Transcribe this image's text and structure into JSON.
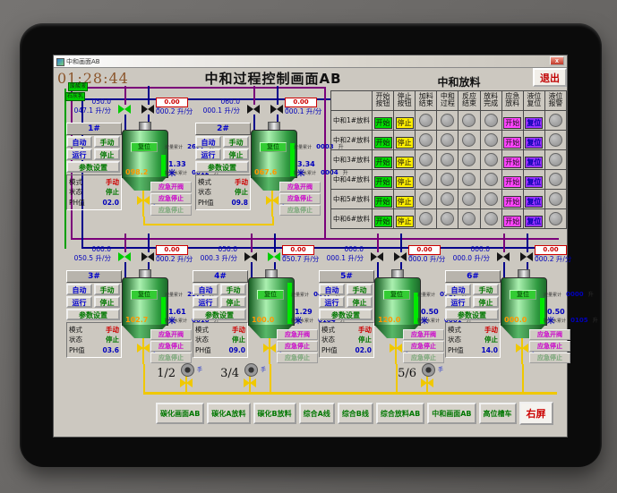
{
  "window": {
    "titlebar": {
      "title": "中和画面AB",
      "close": "x"
    },
    "header": {
      "time": "01:28:44",
      "title": "中和过程控制画面AB",
      "section": "中和放料",
      "exit": "退出"
    }
  },
  "labels": {
    "auto": "自动",
    "manual": "手动",
    "run": "运行",
    "stop": "停止",
    "params": "参数设置",
    "mode": "模式",
    "state": "状态",
    "ph": "PH值",
    "emg_open": "应急开阀",
    "emg_stop": "应急停止",
    "emg_stop2": "应急停止",
    "tank_btn": "复位",
    "flow_unit": "升/分",
    "total_unit": "升",
    "total1": "液量累计",
    "total2": "掺加水累计",
    "hand": "手"
  },
  "sources": [
    "废酸液",
    "石灰乳"
  ],
  "units_top": [
    {
      "id": "1#",
      "fl_sp": "050.0",
      "fl_pv": "047.1",
      "fr_sp": "0.00",
      "fr_pv": "000.2",
      "t1": "2677",
      "t2": "0012",
      "tank": "098.2",
      "level": "1.33 米",
      "mode": "手动",
      "state": "停止",
      "ph": "02.0",
      "lvl": "46%",
      "v1": "#00cc00",
      "v2": "#151515"
    },
    {
      "id": "2#",
      "fl_sp": "060.0",
      "fl_pv": "000.1",
      "fr_sp": "0.00",
      "fr_pv": "000.1",
      "t1": "0003",
      "t2": "0004",
      "tank": "067.6",
      "level": "3.34 米",
      "mode": "手动",
      "state": "停止",
      "ph": "09.8",
      "lvl": "72%",
      "v1": "#151515",
      "v2": "#151515"
    }
  ],
  "units_bottom": [
    {
      "id": "3#",
      "fl_sp": "060.0",
      "fl_pv": "050.5",
      "fr_sp": "0.00",
      "fr_pv": "000.2",
      "t1": "2974",
      "t2": "0010",
      "tank": "102.7",
      "level": "1.61 米",
      "mode": "手动",
      "state": "停止",
      "ph": "03.6",
      "lvl": "58%",
      "v1": "#00cc00",
      "v2": "#151515"
    },
    {
      "id": "4#",
      "fl_sp": "050.0",
      "fl_pv": "000.3",
      "fr_sp": "0.00",
      "fr_pv": "050.7",
      "t1": "0447",
      "t2": "0104",
      "tank": "100.0",
      "level": "1.29 米",
      "mode": "手动",
      "state": "停止",
      "ph": "09.0",
      "lvl": "88%",
      "v1": "#151515",
      "v2": "#00cc00"
    },
    {
      "id": "5#",
      "fl_sp": "000.0",
      "fl_pv": "000.1",
      "fr_sp": "0.00",
      "fr_pv": "000.0",
      "t1": "0787",
      "t2": "0001",
      "tank": "120.0",
      "level": "0.50 米",
      "mode": "手动",
      "state": "停止",
      "ph": "02.0",
      "lvl": "68%",
      "v1": "#151515",
      "v2": "#151515"
    },
    {
      "id": "6#",
      "fl_sp": "000.0",
      "fl_pv": "000.0",
      "fr_sp": "0.00",
      "fr_pv": "000.2",
      "t1": "0000",
      "t2": "0105",
      "tank": "000.0",
      "level": "0.50 米",
      "mode": "手动",
      "state": "停止",
      "ph": "14.0",
      "lvl": "55%",
      "v1": "#151515",
      "v2": "#151515"
    }
  ],
  "pumps": [
    {
      "label": "1/2"
    },
    {
      "label": "3/4"
    },
    {
      "label": "5/6"
    }
  ],
  "table": {
    "headers": [
      {
        "label": "开始按钮"
      },
      {
        "label": "停止按钮"
      },
      {
        "label": "加料结束"
      },
      {
        "label": "中和过程"
      },
      {
        "label": "反应结束"
      },
      {
        "label": "放料完成"
      },
      {
        "label": "应急放料"
      },
      {
        "label": "液位复位"
      },
      {
        "label": "液位报警"
      }
    ],
    "row_buttons": {
      "start": "开始",
      "stop": "停止",
      "emg": "开始",
      "reset": "复位"
    },
    "rows": [
      {
        "name": "中和1#放料"
      },
      {
        "name": "中和2#放料"
      },
      {
        "name": "中和3#放料"
      },
      {
        "name": "中和4#放料"
      },
      {
        "name": "中和5#放料"
      },
      {
        "name": "中和6#放料"
      }
    ]
  },
  "nav_buttons": [
    {
      "label": "碳化画面AB",
      "color": "#007700"
    },
    {
      "label": "碳化A放料",
      "color": "#007700"
    },
    {
      "label": "碳化B放料",
      "color": "#007700"
    },
    {
      "label": "综合A线",
      "color": "#007700"
    },
    {
      "label": "综合B线",
      "color": "#007700"
    },
    {
      "label": "综合放料AB",
      "color": "#007700"
    },
    {
      "label": "中和画面AB",
      "color": "#007700"
    },
    {
      "label": "高位槽车",
      "color": "#007700"
    },
    {
      "label": "右屏",
      "color": "#cc0000"
    }
  ]
}
